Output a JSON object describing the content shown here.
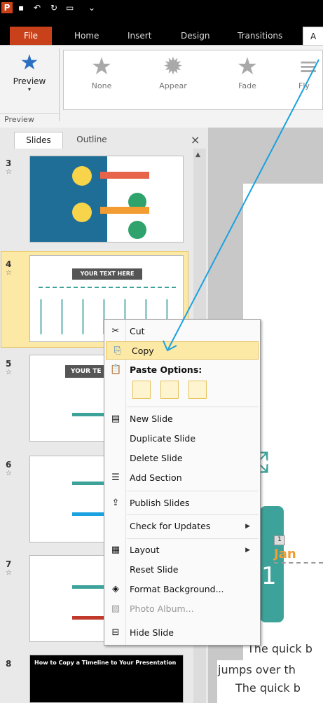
{
  "ribbon": {
    "tabs": [
      "File",
      "Home",
      "Insert",
      "Design",
      "Transitions",
      "A"
    ],
    "preview_label": "Preview",
    "preview_group": "Preview",
    "gallery": [
      "None",
      "Appear",
      "Fade",
      "Fly"
    ]
  },
  "panel": {
    "tabs": [
      "Slides",
      "Outline"
    ],
    "close": "×",
    "slides": [
      {
        "num": "3",
        "text": ""
      },
      {
        "num": "4",
        "text": "YOUR TEXT HERE"
      },
      {
        "num": "5",
        "text": "YOUR TE"
      },
      {
        "num": "6",
        "text": ""
      },
      {
        "num": "7",
        "text": ""
      },
      {
        "num": "8",
        "text": "How to Copy a Timeline to Your Presentation"
      }
    ]
  },
  "slide": {
    "jan": "Jan",
    "one": "1",
    "badge": "1",
    "body": [
      "The quick b",
      "jumps over th",
      "The quick b"
    ]
  },
  "menu": {
    "items": [
      {
        "label": "Cut",
        "icon": "scissors-icon"
      },
      {
        "label": "Copy",
        "icon": "copy-icon"
      },
      {
        "label": "Paste Options:",
        "icon": "paste-icon"
      },
      {
        "label": "New Slide",
        "icon": "new-slide-icon"
      },
      {
        "label": "Duplicate Slide",
        "icon": ""
      },
      {
        "label": "Delete Slide",
        "icon": ""
      },
      {
        "label": "Add Section",
        "icon": "add-section-icon"
      },
      {
        "label": "Publish Slides",
        "icon": "publish-icon"
      },
      {
        "label": "Check for Updates",
        "icon": ""
      },
      {
        "label": "Layout",
        "icon": "layout-icon"
      },
      {
        "label": "Reset Slide",
        "icon": ""
      },
      {
        "label": "Format Background...",
        "icon": "format-background-icon"
      },
      {
        "label": "Photo Album...",
        "icon": "photo-album-icon"
      },
      {
        "label": "Hide Slide",
        "icon": "hide-slide-icon"
      }
    ]
  },
  "colors": {
    "file_tab": "#c8411a",
    "selected": "#fde9a6",
    "accent": "#1aa1e0",
    "teal": "#3da39a",
    "orange": "#f39c32"
  }
}
